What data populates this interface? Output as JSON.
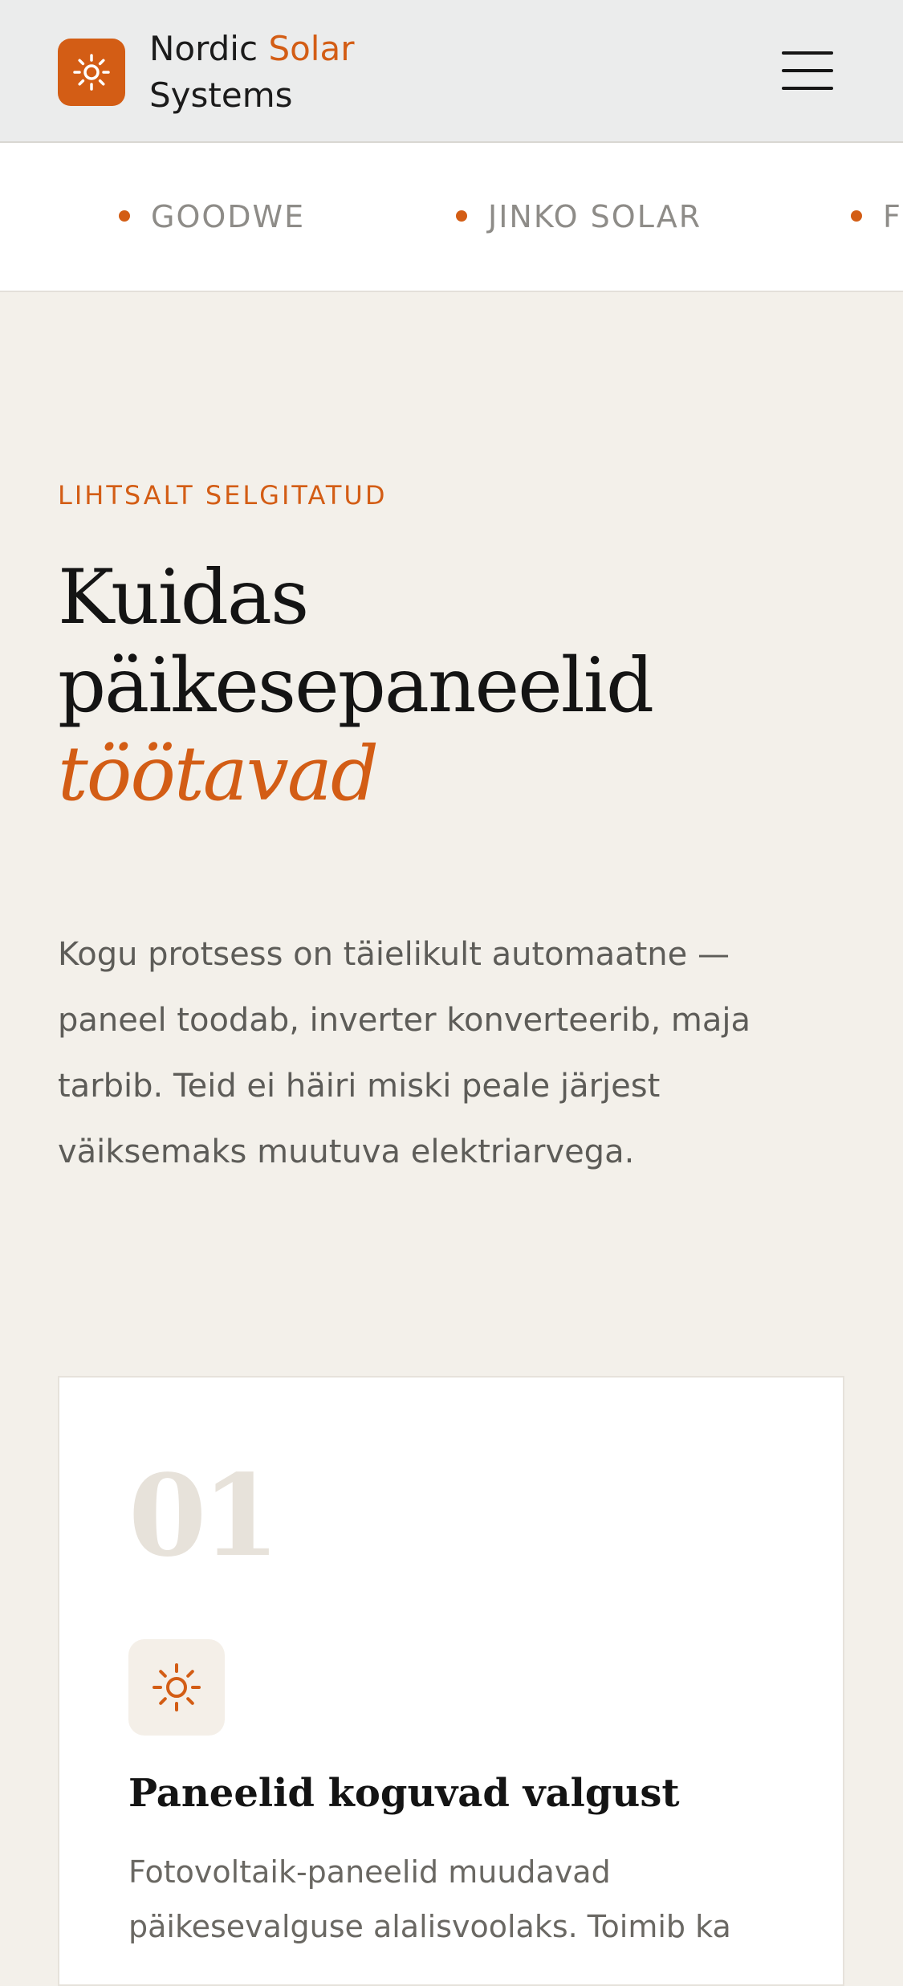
{
  "header": {
    "brand_line1": "Nordic",
    "brand_accent": "Solar",
    "brand_line2": "Systems"
  },
  "ticker": {
    "items": [
      "GOODWE",
      "JINKO SOLAR",
      "F"
    ]
  },
  "section": {
    "eyebrow": "LIHTSALT SELGITATUD",
    "title": "Kuidas päikesepaneelid",
    "title_emphasis": "töötavad",
    "lead": "Kogu protsess on täielikult automaatne — paneel toodab, inverter konverteerib, maja tarbib. Teid ei häiri miski peale järjest väiksemaks muutuva elektriarvega."
  },
  "steps": [
    {
      "number": "01",
      "icon": "sun-icon",
      "title": "Paneelid koguvad valgust",
      "text": "Fotovoltaik-paneelid muudavad päikesevalguse alalisvoolaks. Toimib ka"
    }
  ],
  "colors": {
    "accent": "#d35d15",
    "background": "#f3f0ea",
    "header": "#ebecec"
  }
}
